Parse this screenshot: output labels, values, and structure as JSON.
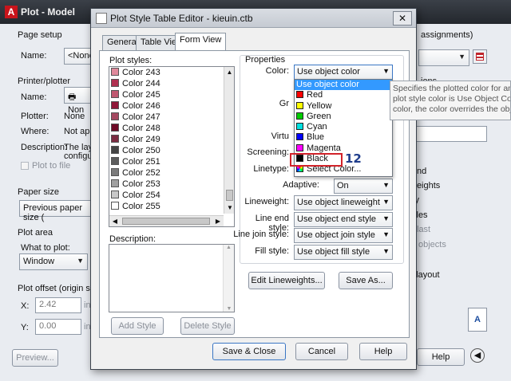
{
  "plot_window": {
    "title": "Plot - Model",
    "sections": {
      "page_setup": "Page setup",
      "name_label": "Name:",
      "name_value": "<None",
      "printer": "Printer/plotter",
      "printer_name_label": "Name:",
      "printer_name_value": "Non",
      "plotter_label": "Plotter:",
      "plotter_value": "None",
      "where_label": "Where:",
      "where_value": "Not appli",
      "description_label": "Description:",
      "description_value_1": "The layo",
      "description_value_2": "configur",
      "plot_to_file": "Plot to file",
      "paper_size": "Paper size",
      "paper_size_value": "Previous paper size (",
      "plot_area": "Plot area",
      "what_to_plot": "What to plot:",
      "what_to_plot_value": "Window",
      "plot_offset": "Plot offset (origin set to",
      "x_label": "X:",
      "x_value": "2.42",
      "x_unit": "in",
      "y_label": "Y:",
      "y_value": "0.00",
      "y_unit": "in",
      "preview_button": "Preview..."
    },
    "right_side": {
      "assignments": "assignments)",
      "options_partial": "ions",
      "background_partial": "nd",
      "lineweights_partial": "weights",
      "transparency_partial": "cy",
      "styles_partial": "yles",
      "last_partial": "last",
      "objects_partial": "objects",
      "layout_partial": "o layout",
      "help_button": "Help"
    }
  },
  "dialog": {
    "title": "Plot Style Table Editor - kieuin.ctb",
    "close_glyph": "✕",
    "tabs": [
      "General",
      "Table View",
      "Form View"
    ],
    "active_tab": "Form View",
    "plot_styles_label": "Plot styles:",
    "plot_styles": [
      {
        "name": "Color 243",
        "color": "#e08a9c"
      },
      {
        "name": "Color 244",
        "color": "#b03050"
      },
      {
        "name": "Color 245",
        "color": "#c05870"
      },
      {
        "name": "Color 246",
        "color": "#901838"
      },
      {
        "name": "Color 247",
        "color": "#a44860"
      },
      {
        "name": "Color 248",
        "color": "#6e0a26"
      },
      {
        "name": "Color 249",
        "color": "#7c2c42"
      },
      {
        "name": "Color 250",
        "color": "#444444"
      },
      {
        "name": "Color 251",
        "color": "#5c5c5c"
      },
      {
        "name": "Color 252",
        "color": "#7c7c7c"
      },
      {
        "name": "Color 253",
        "color": "#a0a0a0"
      },
      {
        "name": "Color 254",
        "color": "#c8c8c8"
      },
      {
        "name": "Color 255",
        "color": "#ffffff"
      }
    ],
    "description_label": "Description:",
    "add_style": "Add Style",
    "delete_style": "Delete Style",
    "properties": {
      "group_label": "Properties",
      "color_label": "Color:",
      "color_value": "Use object color",
      "dither_partial": "Gr",
      "virtual_partial": "Virtu",
      "screening_label": "Screening:",
      "linetype_label": "Linetype:",
      "adaptive_label": "Adaptive:",
      "adaptive_value": "On",
      "lineweight_label": "Lineweight:",
      "lineweight_value": "Use object lineweight",
      "line_end_label": "Line end style:",
      "line_end_value": "Use object end style",
      "line_join_label": "Line join style:",
      "line_join_value": "Use object join style",
      "fill_label": "Fill style:",
      "fill_value": "Use object fill style",
      "edit_lineweights": "Edit Lineweights...",
      "save_as": "Save As..."
    },
    "color_dropdown": [
      {
        "label": "Use object color",
        "swatch": null,
        "selected": true
      },
      {
        "label": "Red",
        "swatch": "#ff0000"
      },
      {
        "label": "Yellow",
        "swatch": "#ffff00"
      },
      {
        "label": "Green",
        "swatch": "#00cc00"
      },
      {
        "label": "Cyan",
        "swatch": "#00e0e0"
      },
      {
        "label": "Blue",
        "swatch": "#0000ff"
      },
      {
        "label": "Magenta",
        "swatch": "#ff00ff"
      },
      {
        "label": "Black",
        "swatch": "#000000"
      },
      {
        "label": "Select Color...",
        "swatch": "multi"
      }
    ],
    "annotation_number": "12",
    "tooltip_lines": [
      "Specifies the plotted color for an",
      "plot style color is Use Object Colo",
      "color, the color overrides the obje"
    ],
    "buttons": {
      "save_close": "Save & Close",
      "cancel": "Cancel",
      "help": "Help"
    }
  },
  "colors": {
    "accent_highlight": "#3399ff",
    "annotation_box": "#d2232a",
    "annotation_text": "#1f3d8c"
  }
}
